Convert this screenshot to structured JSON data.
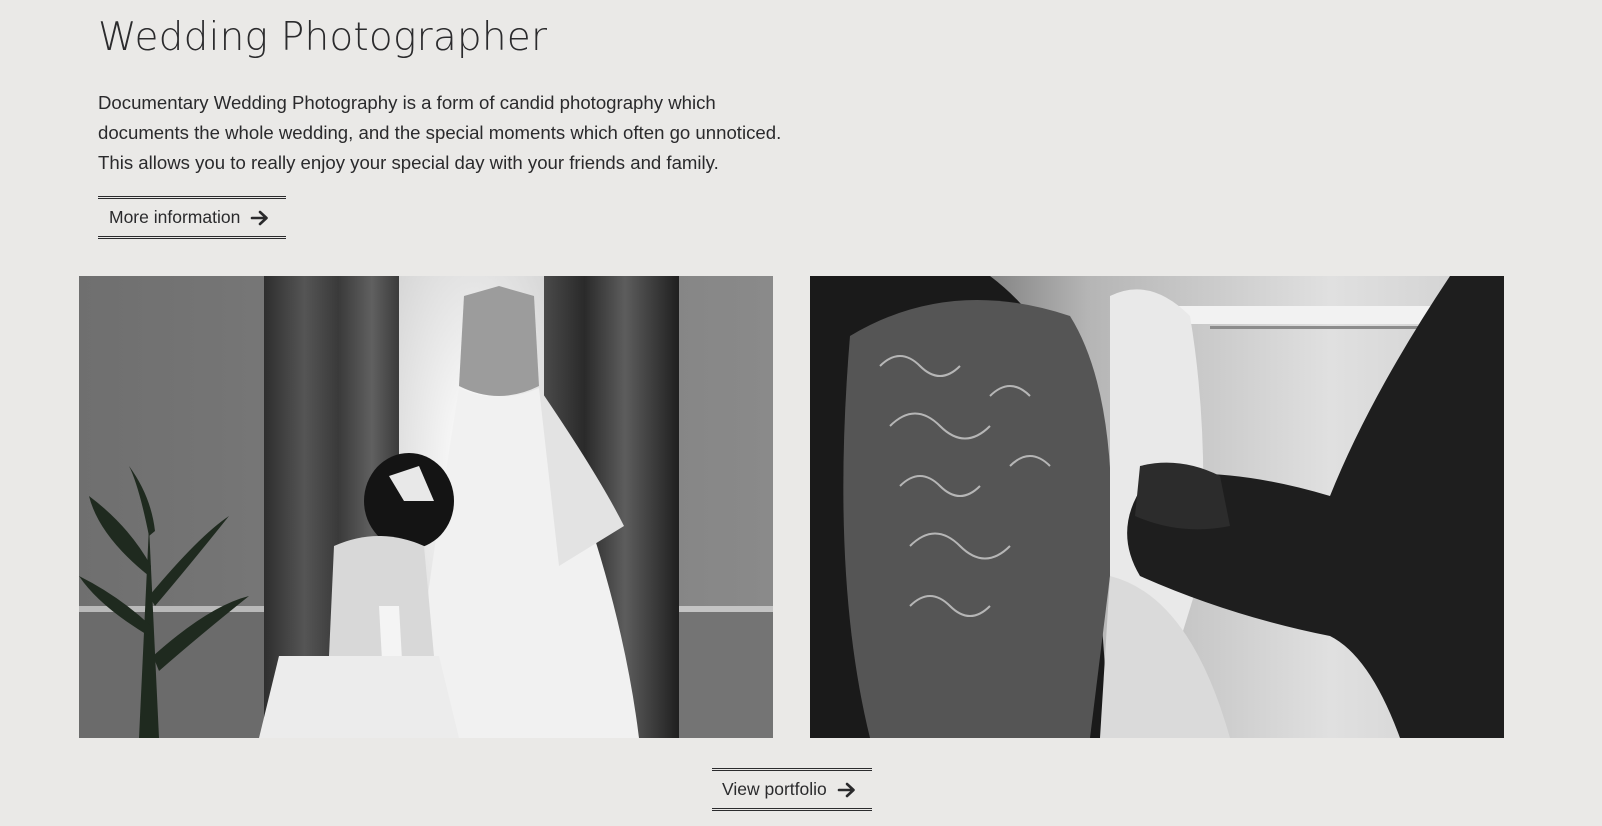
{
  "header": {
    "title": "Wedding Photographer"
  },
  "intro": {
    "lines": [
      "Documentary Wedding Photography is a form of candid photography which",
      "documents the whole wedding, and the special moments which often go unnoticed.",
      "This allows you to really enjoy your special day with your friends and family."
    ]
  },
  "buttons": {
    "more_info_label": "More information",
    "portfolio_label": "View portfolio",
    "arrow_icon": "arrow-right-icon"
  },
  "gallery": {
    "images": [
      {
        "alt": "flower-girl-looking-at-wedding-dress-photo"
      },
      {
        "alt": "bride-lace-dress-buttoned-photo"
      }
    ]
  },
  "colors": {
    "background": "#eae9e7",
    "text": "#2a2a2c"
  }
}
